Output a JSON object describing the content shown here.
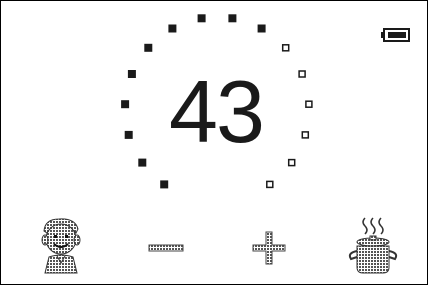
{
  "display": {
    "value": "43",
    "dial": {
      "total_steps": 16,
      "filled_steps": 10
    }
  },
  "colors": {
    "ink": "#1a1a1a",
    "dither": "#6a6a6a",
    "background": "#ffffff"
  },
  "icons": {
    "battery": "battery-icon",
    "avatar": "child-face-icon",
    "minus": "minus-icon",
    "plus": "plus-icon",
    "pot": "steaming-pot-icon"
  }
}
